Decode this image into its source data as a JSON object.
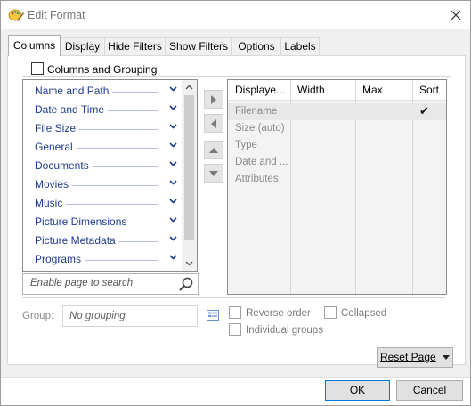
{
  "window": {
    "title": "Edit Format"
  },
  "tabs": [
    {
      "label": "Columns"
    },
    {
      "label": "Display"
    },
    {
      "label": "Hide Filters"
    },
    {
      "label": "Show Filters"
    },
    {
      "label": "Options"
    },
    {
      "label": "Labels"
    }
  ],
  "group_box": {
    "label": "Columns and Grouping",
    "checked": false
  },
  "available": [
    {
      "label": "Name and Path"
    },
    {
      "label": "Date and Time"
    },
    {
      "label": "File Size"
    },
    {
      "label": "General"
    },
    {
      "label": "Documents"
    },
    {
      "label": "Movies"
    },
    {
      "label": "Music"
    },
    {
      "label": "Picture Dimensions"
    },
    {
      "label": "Picture Metadata"
    },
    {
      "label": "Programs"
    }
  ],
  "columns_grid": {
    "headers": [
      "Displaye...",
      "Width",
      "Max",
      "Sort"
    ],
    "rows": [
      {
        "name": "Filename",
        "sort_mark": "✔"
      },
      {
        "name": "Size (auto)",
        "sort_mark": ""
      },
      {
        "name": "Type",
        "sort_mark": ""
      },
      {
        "name": "Date and ...",
        "sort_mark": ""
      },
      {
        "name": "Attributes",
        "sort_mark": ""
      }
    ]
  },
  "search": {
    "placeholder": "Enable page to search"
  },
  "grouping": {
    "label": "Group:",
    "value": "No grouping"
  },
  "options": {
    "reverse_order": "Reverse order",
    "collapsed": "Collapsed",
    "individual_groups": "Individual groups"
  },
  "buttons": {
    "reset": "Reset Page",
    "ok": "OK",
    "cancel": "Cancel"
  },
  "colors": {
    "accent": "#0078d7",
    "list_text": "#1f3b8f"
  }
}
